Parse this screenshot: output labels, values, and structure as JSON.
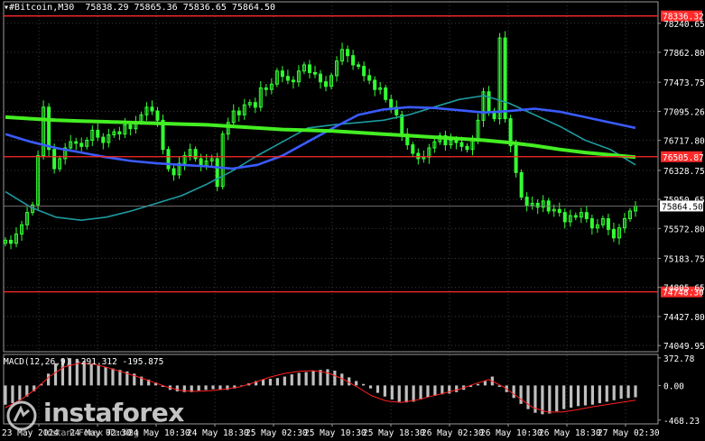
{
  "header": {
    "symbol": "#Bitcoin,M30",
    "ohlc": "75838.29 75865.36 75836.65 75864.50"
  },
  "macd_header": {
    "label": "MACD(12,26,9) -291.312 -195.875"
  },
  "watermark": {
    "brand": "instaforex",
    "tagline": "Instant Forex Trading"
  },
  "colors": {
    "background": "#000000",
    "grid": "#3a3a3a",
    "candle": "#33ff33",
    "ma_fast": "#1e9aa0",
    "ma_mid": "#3a5bff",
    "ma_slow": "#44ee22",
    "level_line": "#ff2a2a",
    "macd_hist": "#bfbfbf",
    "macd_signal": "#ff2020",
    "axis_text": "#ffffff"
  },
  "chart_data": [
    {
      "type": "candlestick",
      "title": "#Bitcoin,M30",
      "y_ticks": [
        78240.65,
        77862.8,
        77473.75,
        77095.26,
        76717.8,
        76328.75,
        75950.65,
        75572.8,
        75183.75,
        74805.65,
        74427.8,
        74049.95
      ],
      "y_tick_labels": [
        "78240.65",
        "77862.80",
        "77473.75",
        "77095.26",
        "76717.80",
        "76328.75",
        "75950.65",
        "75572.80",
        "75183.75",
        "74805.65",
        "74427.80",
        "74049.95"
      ],
      "ylim": [
        73970,
        78520
      ],
      "x_tick_labels": [
        "23 May 2024",
        "24 May 02:30",
        "24 May 10:30",
        "24 May 18:30",
        "25 May 02:30",
        "25 May 10:30",
        "25 May 18:30",
        "26 May 02:30",
        "26 May 10:30",
        "26 May 18:30",
        "27 May 02:30"
      ],
      "horizontal_levels": [
        {
          "value": 78336.32,
          "label": "78336.32"
        },
        {
          "value": 76505.87,
          "label": "76505.87"
        },
        {
          "value": 74748.3,
          "label": "74748.30"
        }
      ],
      "current_price": {
        "value": 75864.5,
        "label": "75864.50"
      },
      "close_series": [
        75420,
        75380,
        75500,
        75620,
        75780,
        75880,
        76520,
        77150,
        76600,
        76350,
        76480,
        76620,
        76700,
        76680,
        76640,
        76720,
        76850,
        76760,
        76690,
        76790,
        76830,
        76800,
        76920,
        76870,
        76960,
        77050,
        77150,
        77100,
        76980,
        76600,
        76350,
        76270,
        76420,
        76520,
        76600,
        76480,
        76390,
        76450,
        76480,
        76120,
        76800,
        76950,
        77100,
        77050,
        77180,
        77210,
        77150,
        77400,
        77380,
        77450,
        77620,
        77550,
        77500,
        77480,
        77620,
        77700,
        77600,
        77580,
        77480,
        77420,
        77560,
        77750,
        77900,
        77820,
        77700,
        77680,
        77560,
        77500,
        77380,
        77400,
        77250,
        77150,
        77050,
        76800,
        76660,
        76550,
        76480,
        76500,
        76620,
        76700,
        76780,
        76660,
        76720,
        76690,
        76640,
        76600,
        76720,
        76980,
        77350,
        77100,
        77000,
        78050,
        77000,
        76650,
        76300,
        75980,
        75870,
        75900,
        75850,
        75930,
        75800,
        75820,
        75780,
        75660,
        75740,
        75720,
        75780,
        75700,
        75580,
        75620,
        75700,
        75560,
        75450,
        75580,
        75700,
        75800,
        75864.5
      ],
      "series": [
        {
          "name": "MA fast",
          "values": [
            76050,
            75850,
            75720,
            75680,
            75720,
            75800,
            75900,
            76000,
            76150,
            76320,
            76520,
            76700,
            76880,
            76920,
            76950,
            76980,
            77050,
            77150,
            77250,
            77300,
            77200,
            77050,
            76900,
            76720,
            76600,
            76400
          ]
        },
        {
          "name": "MA mid",
          "values": [
            76800,
            76700,
            76620,
            76560,
            76500,
            76450,
            76420,
            76400,
            76380,
            76350,
            76400,
            76520,
            76700,
            76880,
            77050,
            77120,
            77150,
            77140,
            77110,
            77080,
            77100,
            77130,
            77090,
            77020,
            76950,
            76880
          ]
        },
        {
          "name": "MA slow",
          "values": [
            77020,
            77000,
            76980,
            76970,
            76960,
            76950,
            76940,
            76930,
            76920,
            76900,
            76880,
            76860,
            76850,
            76840,
            76820,
            76800,
            76780,
            76760,
            76740,
            76720,
            76690,
            76650,
            76600,
            76560,
            76530,
            76500
          ]
        }
      ]
    },
    {
      "type": "bar",
      "title": "MACD(12,26,9)",
      "y_tick_labels": [
        "372.78",
        "0.00",
        "-468.23"
      ],
      "ylim": [
        -520,
        420
      ],
      "values": [
        -260,
        -240,
        -200,
        -150,
        -80,
        20,
        160,
        300,
        360,
        370,
        360,
        330,
        300,
        280,
        250,
        230,
        210,
        190,
        160,
        120,
        80,
        40,
        -20,
        -60,
        -80,
        -90,
        -90,
        -70,
        -60,
        -50,
        -60,
        -60,
        -40,
        -10,
        30,
        60,
        80,
        90,
        100,
        120,
        150,
        170,
        180,
        200,
        210,
        220,
        200,
        160,
        110,
        60,
        20,
        -40,
        -100,
        -150,
        -190,
        -220,
        -230,
        -220,
        -190,
        -160,
        -140,
        -120,
        -110,
        -90,
        -60,
        -20,
        20,
        60,
        120,
        -20,
        -90,
        -170,
        -250,
        -320,
        -370,
        -390,
        -380,
        -350,
        -320,
        -300,
        -280,
        -270,
        -260,
        -240,
        -220,
        -200,
        -180,
        -170,
        -160
      ],
      "series": [
        {
          "name": "Signal",
          "values": [
            -300,
            -200,
            -60,
            120,
            250,
            300,
            290,
            240,
            180,
            120,
            50,
            -20,
            -70,
            -80,
            -70,
            -50,
            -20,
            40,
            110,
            160,
            190,
            200,
            170,
            90,
            -20,
            -140,
            -210,
            -230,
            -200,
            -150,
            -100,
            -50,
            20,
            80,
            -20,
            -160,
            -300,
            -360,
            -360,
            -330,
            -290,
            -260,
            -230,
            -200
          ]
        }
      ]
    }
  ]
}
